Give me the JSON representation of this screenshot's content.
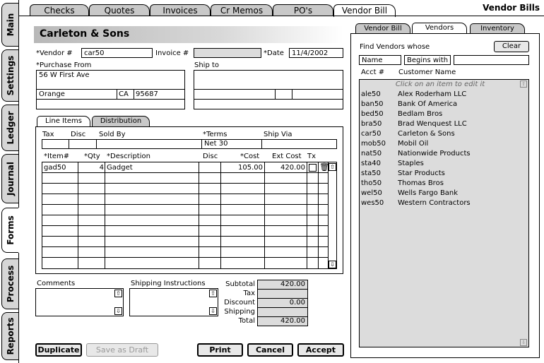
{
  "app_title": "Vendor Bills",
  "side_tabs": [
    "Main",
    "Settings",
    "Ledger",
    "Journal",
    "Forms",
    "Process",
    "Reports"
  ],
  "top_tabs": [
    "Checks",
    "Quotes",
    "Invoices",
    "Cr Memos",
    "PO's",
    "Vendor Bill"
  ],
  "vendor_name": "Carleton & Sons",
  "form": {
    "vendor_label": "*Vendor #",
    "vendor_value": "car50",
    "invoice_label": "Invoice #",
    "invoice_value": "",
    "date_label": "*Date",
    "date_value": "11/4/2002",
    "purchase_from_label": "*Purchase From",
    "address_line1": "56 W First Ave",
    "city": "Orange",
    "state": "CA",
    "zip": "95687",
    "ship_to_label": "Ship to"
  },
  "sub_tabs": [
    "Line Items",
    "Distribution"
  ],
  "terms_headers": {
    "tax": "Tax",
    "disc": "Disc",
    "sold_by": "Sold By",
    "terms": "*Terms",
    "ship_via": "Ship Via"
  },
  "terms_value": "Net 30",
  "line_headers": {
    "item": "*Item#",
    "qty": "*Qty",
    "description": "*Description",
    "disc": "Disc",
    "cost": "*Cost",
    "ext_cost": "Ext Cost",
    "tx": "Tx"
  },
  "line_items": [
    {
      "item": "gad50",
      "qty": "4",
      "description": "Gadget",
      "disc": "",
      "cost": "105.00",
      "ext_cost": "420.00"
    }
  ],
  "comments_label": "Comments",
  "shipping_label": "Shipping Instructions",
  "totals": {
    "subtotal_label": "Subtotal",
    "subtotal": "420.00",
    "tax_label": "Tax",
    "tax": "",
    "discount_label": "Discount",
    "discount": "0.00",
    "shipping_label": "Shipping",
    "shipping": "",
    "total_label": "Total",
    "total": "420.00"
  },
  "buttons": {
    "duplicate": "Duplicate",
    "save_draft": "Save as Draft",
    "print": "Print",
    "cancel": "Cancel",
    "accept": "Accept"
  },
  "right_tabs": [
    "Vendor Bill",
    "Vendors",
    "Inventory"
  ],
  "finder": {
    "title": "Find Vendors whose",
    "clear": "Clear",
    "field": "Name",
    "op": "Begins with",
    "value": "",
    "col_acct": "Acct #",
    "col_name": "Customer Name",
    "hint": "Click on an item to edit it"
  },
  "vendors": [
    {
      "acct": "ale50",
      "name": "Alex Roderham LLC"
    },
    {
      "acct": "ban50",
      "name": "Bank Of America"
    },
    {
      "acct": "bed50",
      "name": "Bedlam Bros"
    },
    {
      "acct": "bra50",
      "name": "Brad Wenquest LLC"
    },
    {
      "acct": "car50",
      "name": "Carleton & Sons"
    },
    {
      "acct": "mob50",
      "name": "Mobil Oil"
    },
    {
      "acct": "nat50",
      "name": "Nationwide Products"
    },
    {
      "acct": "sta40",
      "name": "Staples"
    },
    {
      "acct": "sta50",
      "name": "Star Products"
    },
    {
      "acct": "tho50",
      "name": "Thomas Bros"
    },
    {
      "acct": "wel50",
      "name": "Wells Fargo Bank"
    },
    {
      "acct": "wes50",
      "name": "Western Contractors"
    }
  ]
}
